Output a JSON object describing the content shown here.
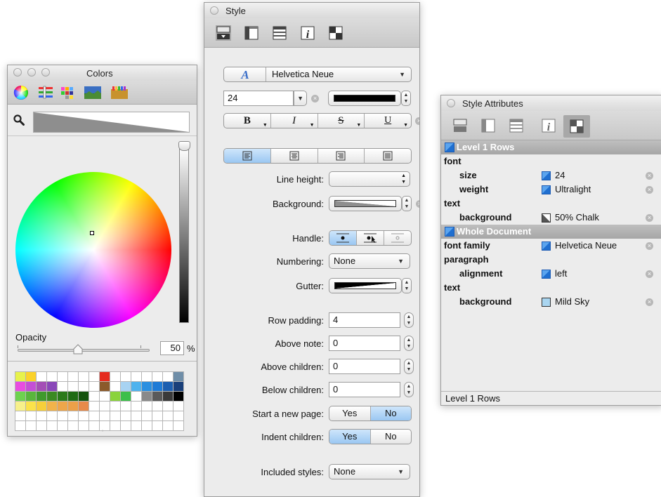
{
  "colors_panel": {
    "title": "Colors",
    "toolbar_icons": [
      "color-wheel-icon",
      "color-sliders-icon",
      "color-palettes-icon",
      "image-palettes-icon",
      "crayons-icon"
    ],
    "opacity_label": "Opacity",
    "opacity_value": "50",
    "opacity_unit": "%",
    "swatch_rows": [
      [
        "#e7f24b",
        "#fbd22a",
        "",
        "",
        "",
        "",
        "",
        "",
        "#e52b1f",
        "",
        "",
        "",
        "",
        "",
        "",
        "#6f8ea8"
      ],
      [
        "#e84de0",
        "#c44fd6",
        "#a44fb6",
        "#8a48b8",
        "",
        "",
        "",
        "",
        "#8b5a2b",
        "",
        "#a8d3f2",
        "#4fb3ee",
        "#2a8fe0",
        "#1f7bd6",
        "#1d5fb0",
        "#193f7a"
      ],
      [
        "#6ed24f",
        "#59b63c",
        "#3f9a2c",
        "#3a8a22",
        "#2b7a1a",
        "#1f6b14",
        "#14520d",
        "",
        "",
        "#8ad33d",
        "#3cbf4a",
        "",
        "#8a8a8a",
        "#5a5a5a",
        "#3a3a3a",
        "#000000"
      ],
      [
        "#f7f08a",
        "#fbe24a",
        "#f7cf3a",
        "#f2b34a",
        "#eea64a",
        "#eda048",
        "#e88a4a",
        "",
        "",
        "",
        "",
        "",
        "",
        "",
        "",
        ""
      ],
      [
        "",
        "",
        "",
        "",
        "",
        "",
        "",
        "",
        "",
        "",
        "",
        "",
        "",
        "",
        "",
        ""
      ],
      [
        "",
        "",
        "",
        "",
        "",
        "",
        "",
        "",
        "",
        "",
        "",
        "",
        "",
        "",
        "",
        ""
      ]
    ]
  },
  "style_panel": {
    "title": "Style",
    "font_name": "Helvetica Neue",
    "font_size": "24",
    "bold_label": "B",
    "italic_label": "I",
    "strike_label": "S",
    "underline_label": "U",
    "labels": {
      "line_height": "Line height:",
      "background": "Background:",
      "handle": "Handle:",
      "numbering": "Numbering:",
      "gutter": "Gutter:",
      "row_padding": "Row padding:",
      "above_note": "Above note:",
      "above_children": "Above children:",
      "below_children": "Below children:",
      "start_new_page": "Start a new page:",
      "indent_children": "Indent children:",
      "included_styles": "Included styles:"
    },
    "numbering_value": "None",
    "row_padding_value": "4",
    "above_note_value": "0",
    "above_children_value": "0",
    "below_children_value": "0",
    "yes_label": "Yes",
    "no_label": "No",
    "start_new_page_selected": "No",
    "indent_children_selected": "Yes",
    "included_styles_value": "None",
    "alignment_selected": "left"
  },
  "attrs_panel": {
    "title": "Style Attributes",
    "groups": [
      {
        "header": "Level 1 Rows",
        "rows": [
          {
            "key": "font",
            "indent": 0
          },
          {
            "key": "size",
            "indent": 1,
            "value": "24",
            "icon": "style-value-icon"
          },
          {
            "key": "weight",
            "indent": 1,
            "value": "Ultralight",
            "icon": "style-value-icon"
          },
          {
            "key": "text",
            "indent": 0
          },
          {
            "key": "background",
            "indent": 1,
            "value": "50% Chalk",
            "icon": "chalk-swatch-icon"
          }
        ]
      },
      {
        "header": "Whole Document",
        "rows": [
          {
            "key": "font family",
            "indent": 0,
            "value": "Helvetica Neue",
            "icon": "style-value-icon"
          },
          {
            "key": "paragraph",
            "indent": 0
          },
          {
            "key": "alignment",
            "indent": 1,
            "value": "left",
            "icon": "style-value-icon"
          },
          {
            "key": "text",
            "indent": 0
          },
          {
            "key": "background",
            "indent": 1,
            "value": "Mild Sky",
            "icon": "sky-swatch-icon"
          }
        ]
      }
    ],
    "footer": "Level 1 Rows"
  }
}
